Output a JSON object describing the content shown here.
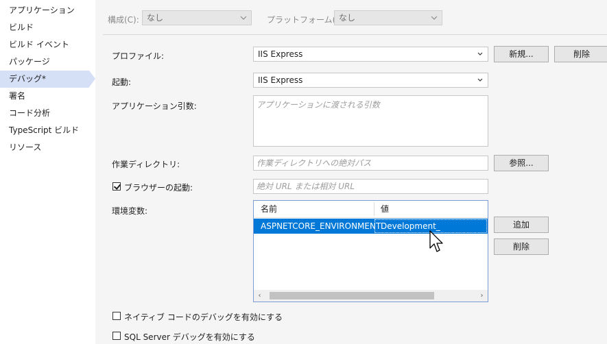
{
  "sidebar": {
    "items": [
      {
        "label": "アプリケーション"
      },
      {
        "label": "ビルド"
      },
      {
        "label": "ビルド イベント"
      },
      {
        "label": "パッケージ"
      },
      {
        "label": "デバッグ*"
      },
      {
        "label": "署名"
      },
      {
        "label": "コード分析"
      },
      {
        "label": "TypeScript ビルド"
      },
      {
        "label": "リソース"
      }
    ],
    "selected": "デバッグ*"
  },
  "topbar": {
    "config_label": "構成(C):",
    "config_value": "なし",
    "platform_label": "プラットフォーム(M):",
    "platform_value": "なし"
  },
  "profile": {
    "label": "プロファイル:",
    "value": "IIS Express",
    "new_button": "新規...",
    "delete_button": "削除"
  },
  "launch": {
    "label": "起動:",
    "value": "IIS Express"
  },
  "app_args": {
    "label": "アプリケーション引数:",
    "placeholder": "アプリケーションに渡される引数"
  },
  "working_dir": {
    "label": "作業ディレクトリ:",
    "placeholder": "作業ディレクトリへの絶対パス",
    "browse_button": "参照..."
  },
  "browser_launch": {
    "label": "ブラウザーの起動:",
    "checked": true,
    "placeholder": "絶対 URL または相対 URL"
  },
  "env_vars": {
    "label": "環境変数:",
    "columns": [
      "名前",
      "値"
    ],
    "rows": [
      {
        "name": "ASPNETCORE_ENVIRONMENT",
        "value": "Development_"
      }
    ],
    "add_button": "追加",
    "delete_button": "削除"
  },
  "options": {
    "native_debug": {
      "label": "ネイティブ コードのデバッグを有効にする",
      "checked": false
    },
    "sql_debug": {
      "label": "SQL Server デバッグを有効にする",
      "checked": false
    }
  },
  "colors": {
    "selection": "#0078d7",
    "sidebar_selected": "#d5dff6",
    "panel_bg": "#f5f5f5"
  }
}
